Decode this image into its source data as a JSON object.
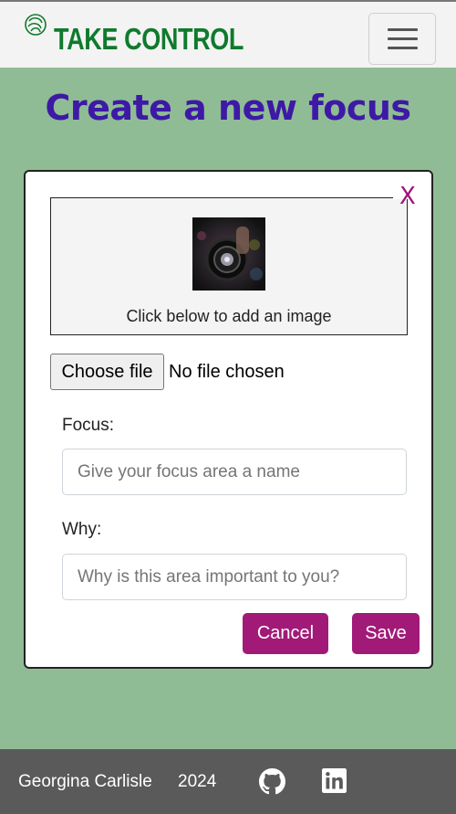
{
  "navbar": {
    "brand": "TAKE CONTROL",
    "logo_icon": "leaf-swirl-icon",
    "menu_icon": "hamburger-icon"
  },
  "page": {
    "title": "Create a new focus"
  },
  "modal": {
    "close_label": "X",
    "image_caption": "Click below to add an image",
    "file_button": "Choose file",
    "file_status": "No file chosen",
    "focus_label": "Focus:",
    "focus_placeholder": "Give your focus area a name",
    "focus_value": "",
    "why_label": "Why:",
    "why_placeholder": "Why is this area important to you?",
    "why_value": "",
    "cancel_label": "Cancel",
    "save_label": "Save"
  },
  "footer": {
    "name": "Georgina Carlisle",
    "year": "2024",
    "github_icon": "github-icon",
    "linkedin_icon": "linkedin-icon"
  },
  "colors": {
    "background": "#8fbc94",
    "brand": "#0f7a2c",
    "title": "#3d19a6",
    "accent": "#a11a78",
    "footer": "#5a5a5a"
  }
}
